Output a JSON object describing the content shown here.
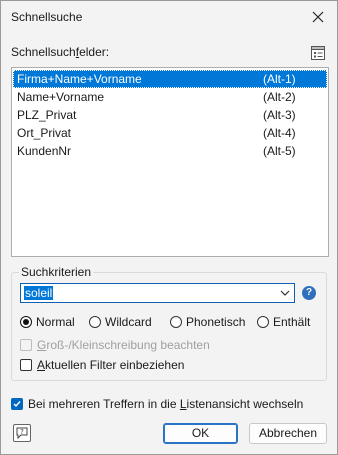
{
  "window": {
    "title": "Schnellsuche"
  },
  "fields": {
    "label_pre": "Schnellsuch",
    "label_underlined": "f",
    "label_post": "elder:",
    "items": [
      {
        "name": "Firma+Name+Vorname",
        "key": "(Alt-1)",
        "selected": true
      },
      {
        "name": "Name+Vorname",
        "key": "(Alt-2)",
        "selected": false
      },
      {
        "name": "PLZ_Privat",
        "key": "(Alt-3)",
        "selected": false
      },
      {
        "name": "Ort_Privat",
        "key": "(Alt-4)",
        "selected": false
      },
      {
        "name": "KundenNr",
        "key": "(Alt-5)",
        "selected": false
      }
    ]
  },
  "criteria": {
    "group_title": "Suchkriterien",
    "search_value": "soleil",
    "modes": [
      {
        "label": "Normal",
        "checked": true
      },
      {
        "label": "Wildcard",
        "checked": false
      },
      {
        "label": "Phonetisch",
        "checked": false
      },
      {
        "label": "Enthält",
        "checked": false
      }
    ],
    "case_sensitive": {
      "label_underlined": "G",
      "label_rest": "roß-/Kleinschreibung beachten",
      "checked": false,
      "enabled": false
    },
    "current_filter": {
      "label_underlined": "A",
      "label_rest": "ktuellen Filter einbeziehen",
      "checked": false,
      "enabled": true
    }
  },
  "list_view_switch": {
    "label_pre": "Bei mehreren Treffern in die ",
    "label_underlined": "L",
    "label_post": "istenansicht wechseln",
    "checked": true
  },
  "buttons": {
    "ok": "OK",
    "cancel": "Abbrechen"
  },
  "colors": {
    "accent": "#0078d7",
    "checkbox_checked": "#0067c0"
  }
}
